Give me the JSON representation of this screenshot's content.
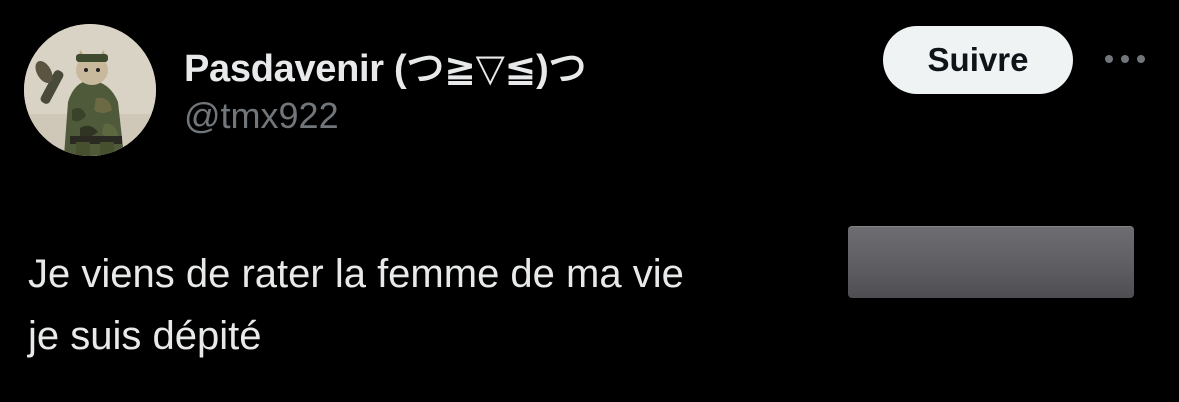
{
  "author": {
    "display_name": "Pasdavenir (つ≧▽≦)つ",
    "handle": "@tmx922"
  },
  "actions": {
    "follow_label": "Suivre",
    "more_icon": "more-horizontal-icon"
  },
  "tweet": {
    "line1": "Je viens de rater la femme de ma vie",
    "line2": "je suis dépité"
  },
  "colors": {
    "background": "#000000",
    "primary_text": "#e7e9ea",
    "secondary_text": "#71767b",
    "follow_button_bg": "#eff3f4",
    "follow_button_text": "#0f1419"
  }
}
